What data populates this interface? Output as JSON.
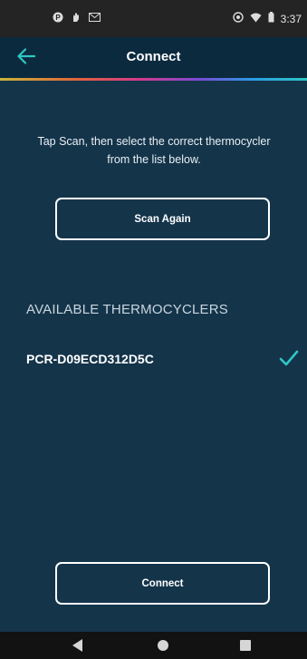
{
  "status_bar": {
    "left_icons": [
      "notification-p-icon",
      "hand-icon",
      "gmail-icon"
    ],
    "right_icons": [
      "sync-icon",
      "wifi-icon",
      "battery-icon"
    ],
    "time": "3:37"
  },
  "header": {
    "title": "Connect",
    "back_icon": "arrow-left-icon"
  },
  "main": {
    "instructions": "Tap Scan, then select the correct thermocycler from the list below.",
    "scan_button_label": "Scan Again",
    "section_header": "AVAILABLE THERMOCYCLERS",
    "devices": [
      {
        "name": "PCR-D09ECD312D5C",
        "selected": true
      }
    ],
    "connect_button_label": "Connect"
  },
  "colors": {
    "background": "#14344a",
    "app_bar": "#0c2a3e",
    "accent": "#2ec7c4"
  }
}
